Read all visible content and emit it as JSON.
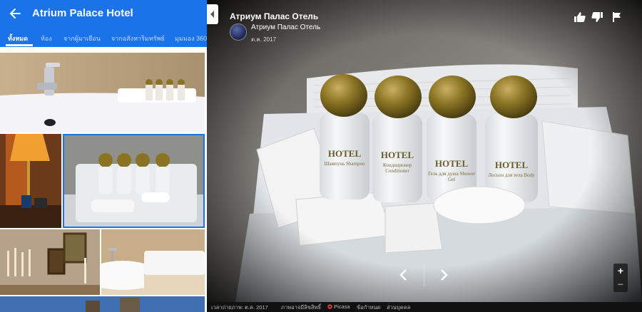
{
  "header": {
    "title": "Atrium Palace Hotel",
    "tabs": [
      {
        "label": "ทั้งหมด",
        "active": true
      },
      {
        "label": "ห้อง",
        "active": false
      },
      {
        "label": "จากผู้มาเยือน",
        "active": false
      },
      {
        "label": "จากอสังหาริมทรัพย์",
        "active": false
      },
      {
        "label": "มุมมอง 360",
        "active": false
      }
    ]
  },
  "viewer": {
    "title": "Атриум Палас Отель",
    "author": "Атриум Палас Отель",
    "date": "ต.ค. 2017",
    "photo_bottle_labels": [
      "HOTEL",
      "HOTEL",
      "HOTEL",
      "HOTEL"
    ],
    "photo_bottle_sublabels": [
      "Шампунь Shampoo",
      "Кондиционер Conditioner",
      "Гель для душа Shower Gel",
      "Лосьон для тела Body"
    ]
  },
  "zoom": {
    "plus": "+",
    "minus": "−"
  },
  "footer": {
    "capture": "เวลาถ่ายภาพ: ต.ค. 2017",
    "copyright": "ภาพอาจมีลิขสิทธิ์",
    "picasa": "Picasa",
    "terms": "ข้อกำหนด",
    "privacy": "ส่วนบุคคล"
  },
  "colors": {
    "accent": "#1a73e8",
    "gold": "#8a7424"
  },
  "icons": [
    "back-arrow-icon",
    "thumbs-up-icon",
    "thumbs-down-icon",
    "flag-icon",
    "chevron-left-icon",
    "chevron-right-icon",
    "collapse-panel-icon",
    "picasa-icon"
  ]
}
